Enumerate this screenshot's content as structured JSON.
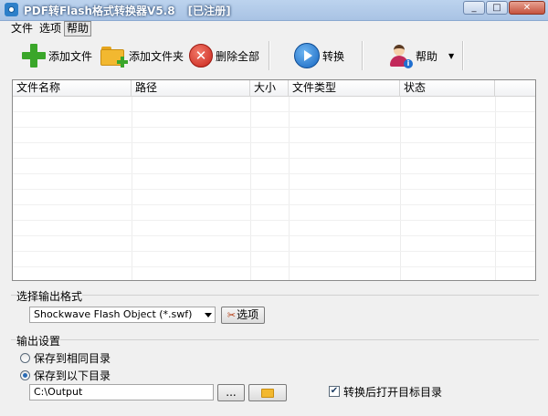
{
  "window": {
    "title": "PDF转Flash格式转换器V5.8",
    "registration": "[已注册]",
    "minimize": "_",
    "maximize": "□",
    "close": "✕"
  },
  "menu": [
    "文件",
    "选项",
    "帮助"
  ],
  "toolbar": {
    "add_file": "添加文件",
    "add_folder": "添加文件夹",
    "delete_all": "删除全部",
    "convert": "转换",
    "help": "帮助",
    "help_caret": "▼"
  },
  "file_list": {
    "columns": [
      "文件名称",
      "路径",
      "大小",
      "文件类型",
      "状态"
    ],
    "rows": []
  },
  "output_format": {
    "group_title": "选择输出格式",
    "selected": "Shockwave Flash Object (*.swf)",
    "options_button": "选项"
  },
  "output_settings": {
    "group_title": "输出设置",
    "radio_same_dir": "保存到相同目录",
    "radio_custom_dir": "保存到以下目录",
    "selected_radio": "custom",
    "path": "C:\\Output",
    "browse_button": "...",
    "open_after_label": "转换后打开目标目录",
    "open_after_checked": true
  }
}
